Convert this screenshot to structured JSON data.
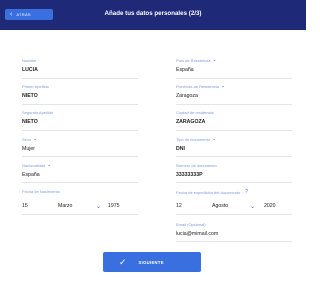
{
  "header": {
    "back_label": "ATRÁS",
    "title": "Añade tus datos personales (2/3)"
  },
  "left": {
    "nombre": {
      "label": "Nombre",
      "value": "LUCIA"
    },
    "primer_apellido": {
      "label": "Primer Apellido",
      "value": "NIETO"
    },
    "segundo_apellido": {
      "label": "Segundo Apellido",
      "value": "NIETO"
    },
    "sexo": {
      "label": "Sexo",
      "value": "Mujer"
    },
    "nacionalidad": {
      "label": "Nacionalidad",
      "value": "España"
    },
    "fecha_nacimiento": {
      "label": "Fecha de Nacimiento",
      "day": "15",
      "month": "Marzo",
      "year": "1975"
    }
  },
  "right": {
    "pais": {
      "label": "País de Residencia",
      "value": "España"
    },
    "provincia": {
      "label": "Provincia de Residencia",
      "value": "Zaragoza"
    },
    "ciudad": {
      "label": "Ciudad de residencia",
      "value": "ZARAGOZA"
    },
    "tipo_documento": {
      "label": "Tipo de documento",
      "value": "DNI"
    },
    "numero_documento": {
      "label": "Número de documento",
      "value": "33333333P"
    },
    "fecha_expedicion": {
      "label": "Fecha de expedición del documento",
      "day": "12",
      "month": "Agosto",
      "year": "2020"
    },
    "email": {
      "label": "Email (Opcional)",
      "value": "lucia@mimail.com"
    }
  },
  "footer": {
    "next_label": "SIGUIENTE"
  }
}
